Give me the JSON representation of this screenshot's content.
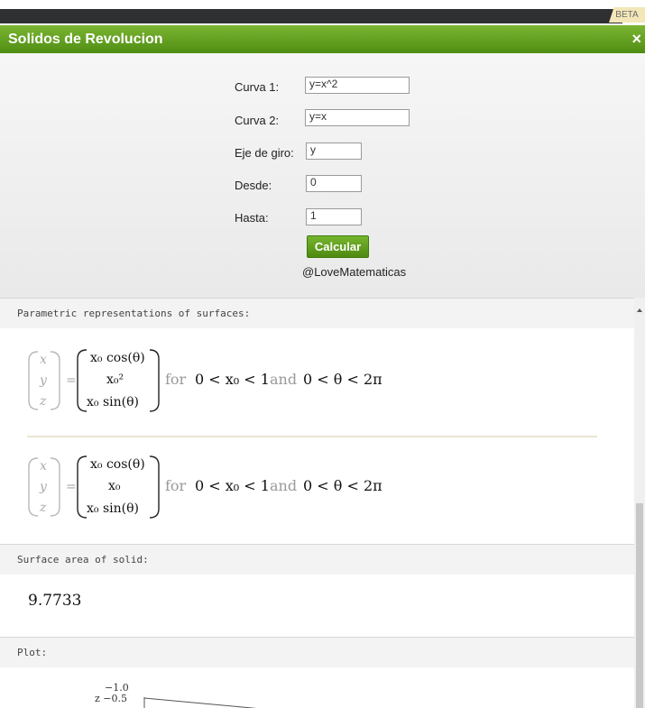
{
  "header": {
    "beta": "BETA",
    "title": "Solidos de Revolucion",
    "close": "×"
  },
  "form": {
    "curva1": {
      "label": "Curva 1:",
      "value": "y=x^2"
    },
    "curva2": {
      "label": "Curva 2:",
      "value": "y=x"
    },
    "eje": {
      "label": "Eje de giro:",
      "value": "y"
    },
    "desde": {
      "label": "Desde:",
      "value": "0"
    },
    "hasta": {
      "label": "Hasta:",
      "value": "1"
    },
    "calcular": "Calcular",
    "credit": "@LoveMatematicas"
  },
  "results": {
    "param_title": "Parametric representations of surfaces:",
    "vars": {
      "x": "x",
      "y": "y",
      "z": "z",
      "eq": "="
    },
    "param1": {
      "r1": "x₀ cos(θ)",
      "r2": "x₀²",
      "r3": "x₀ sin(θ)",
      "cond": "0 < x₀ < 1",
      "and": "and",
      "cond2": "0 < θ < 2π",
      "for": "for"
    },
    "param2": {
      "r1": "x₀ cos(θ)",
      "r2": "x₀",
      "r3": "x₀ sin(θ)",
      "cond": "0 < x₀ < 1",
      "and": "and",
      "cond2": "0 < θ < 2π",
      "for": "for"
    },
    "area_title": "Surface area of solid:",
    "area_value": "9.7733",
    "plot_title": "Plot:",
    "plot_ticks": {
      "t1": "−1.0",
      "t2": "z −0.5"
    }
  }
}
